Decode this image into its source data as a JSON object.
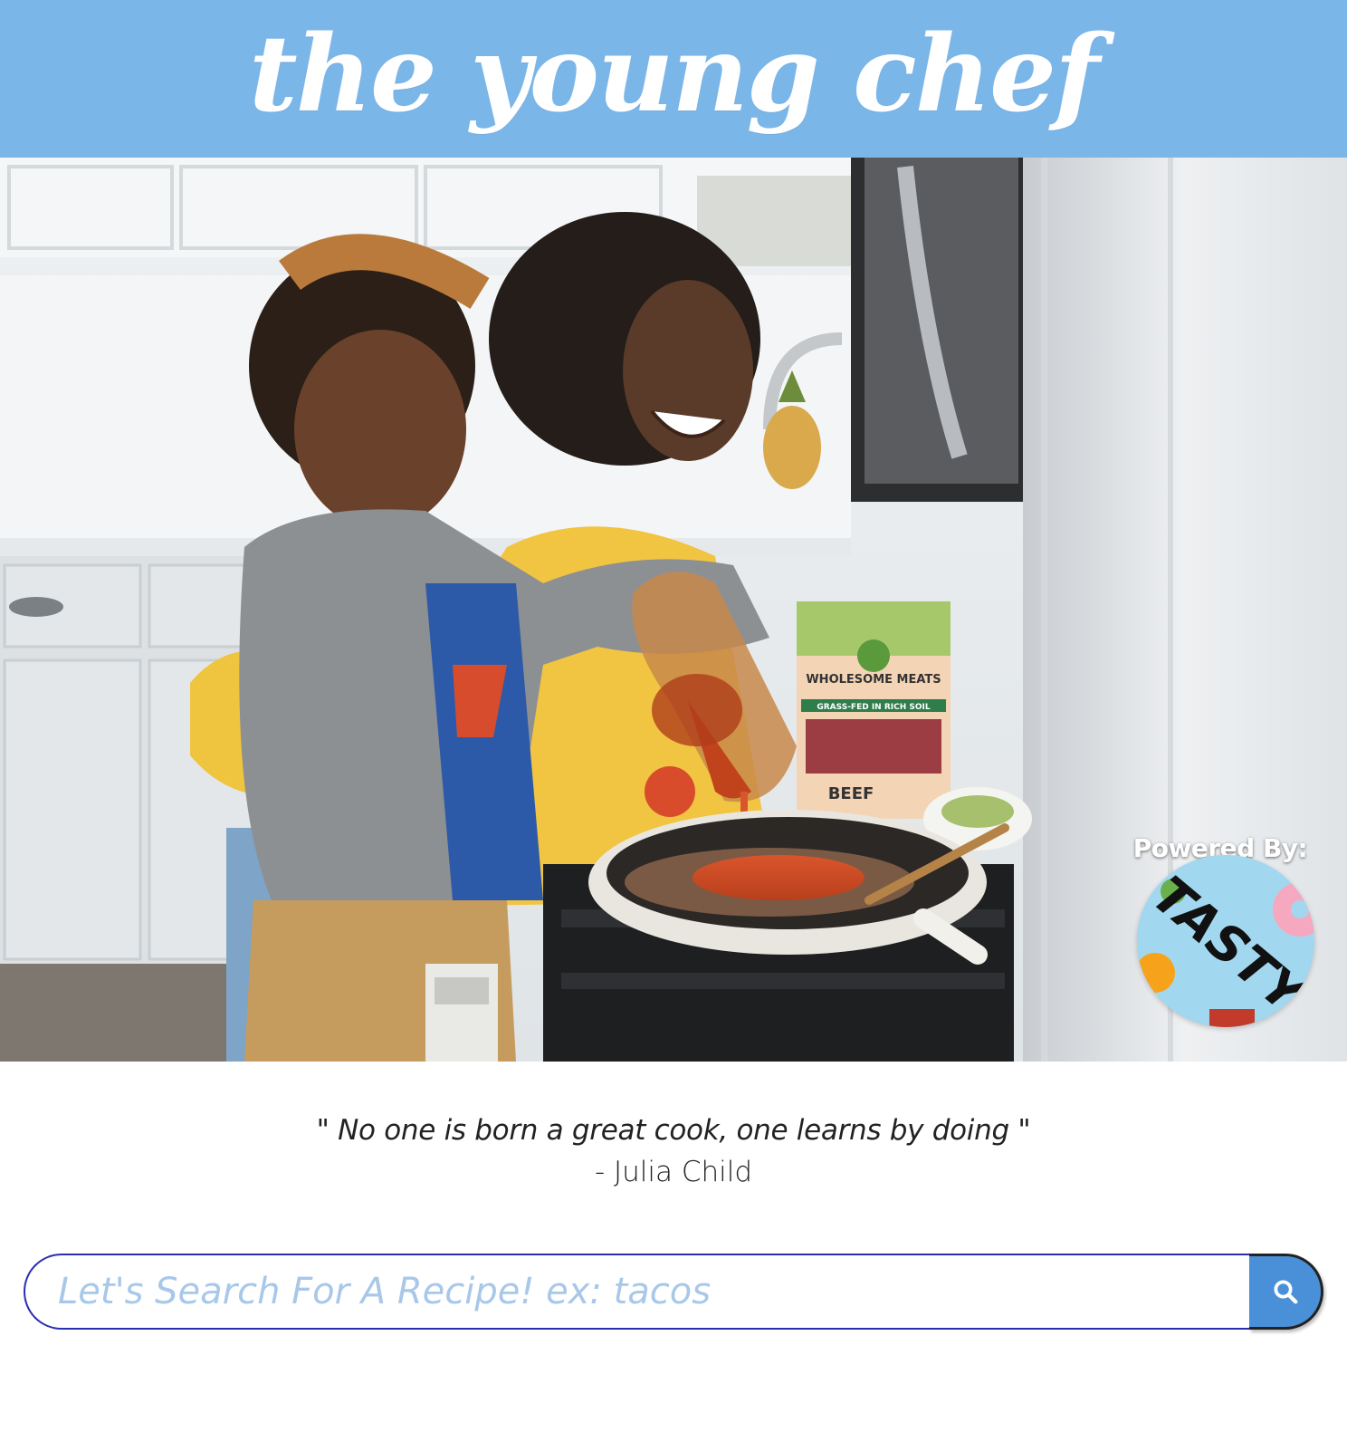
{
  "header": {
    "title": "the young chef",
    "background_color": "#7bb6e9"
  },
  "hero": {
    "packet_brand": "WHOLESOME MEATS",
    "packet_tagline": "GRASS-FED IN RICH SOIL",
    "packet_product": "BEEF"
  },
  "powered_by": {
    "label": "Powered By:",
    "logo_text": "TASTY"
  },
  "quote": {
    "text": "\" No one is born a great cook, one learns by doing \"",
    "author": "- Julia Child"
  },
  "search": {
    "placeholder": "Let's Search For A Recipe! ex: tacos",
    "value": "",
    "button_icon": "search-icon",
    "border_color": "#2a2fb1",
    "button_color": "#4a90d9"
  }
}
